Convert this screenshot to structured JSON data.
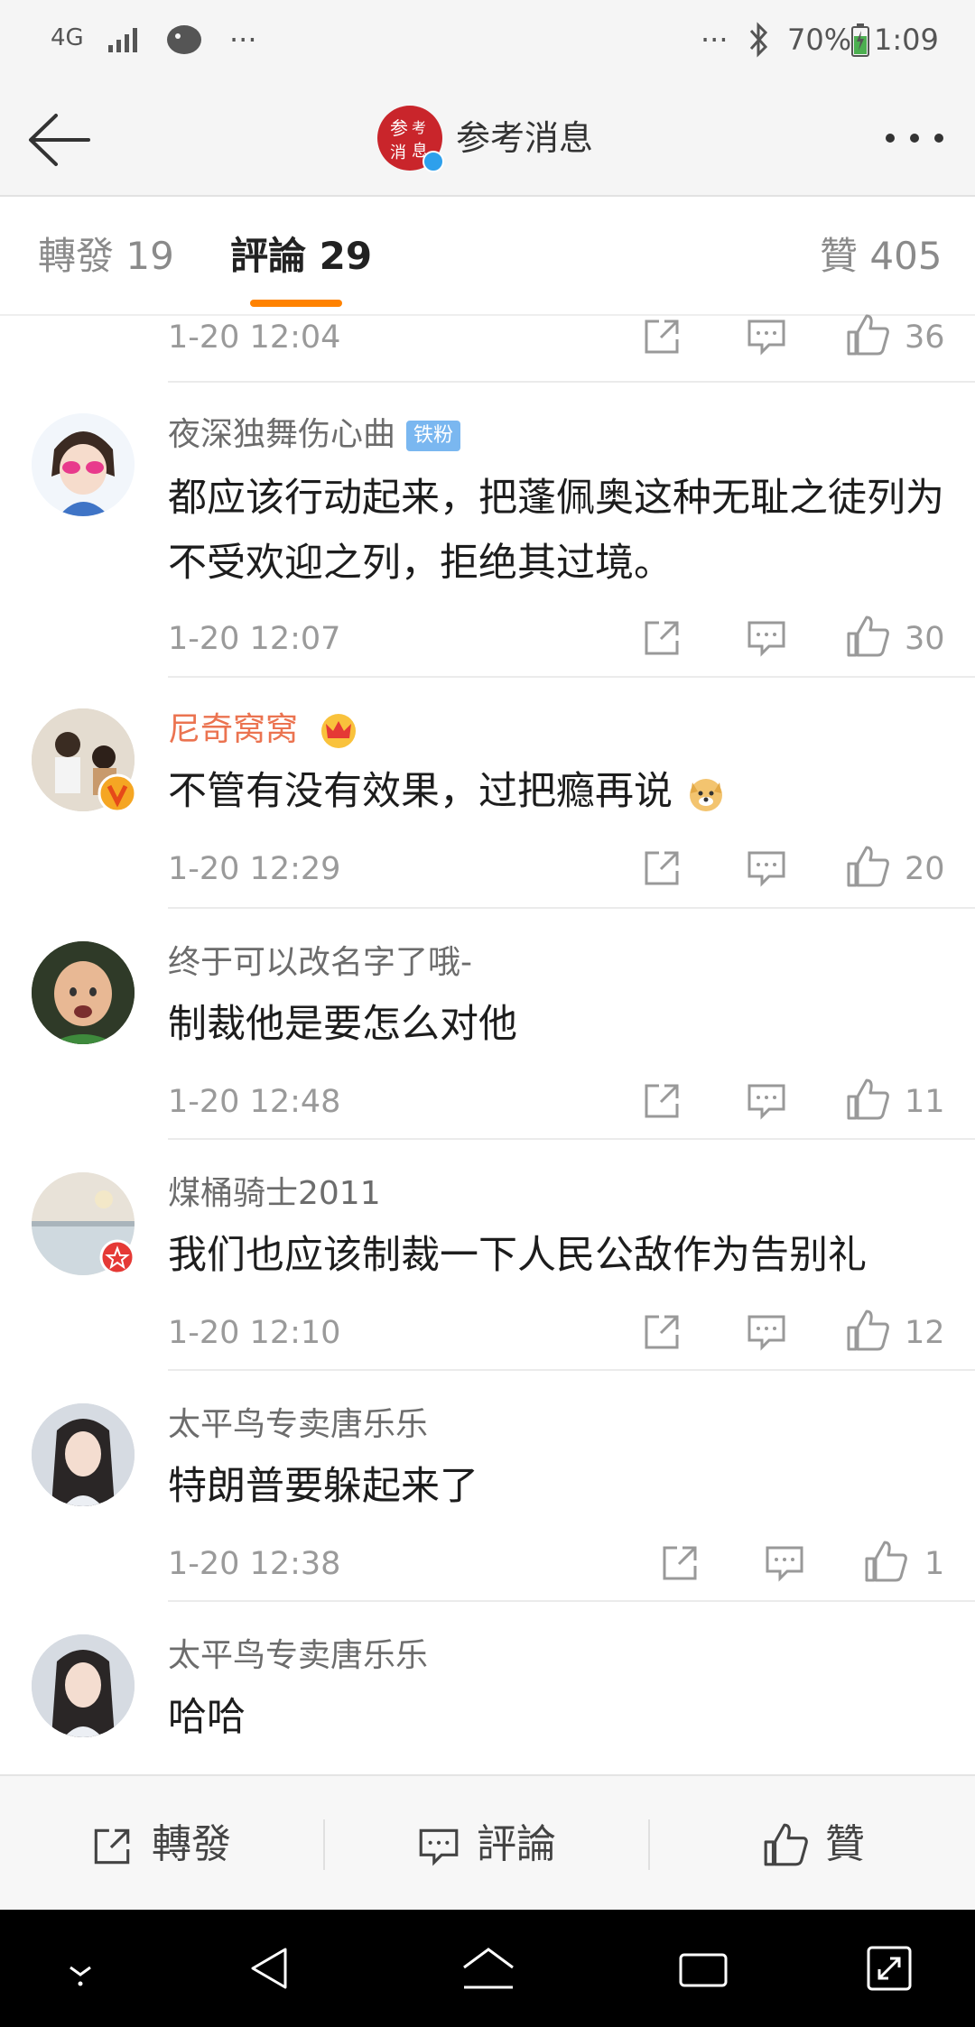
{
  "status_bar": {
    "network": "4G",
    "dots_left": "···",
    "dots_right": "···",
    "battery": "70%",
    "time": "1:09"
  },
  "header": {
    "title": "参考消息",
    "back_icon": "arrow-left-icon",
    "more_icon": "more-dots-icon"
  },
  "tabs": {
    "repost": "轉發 19",
    "comments": "評論 29",
    "likes": "贊 405"
  },
  "colors": {
    "accent": "#ff8200",
    "vip_name": "#eb7350",
    "link_tag": "#7ab7f0"
  },
  "comments": [
    {
      "time": "1-20 12:04",
      "likes": "36"
    },
    {
      "name": "夜深独舞伤心曲",
      "badge": "铁粉",
      "text": "都应该行动起来，把蓬佩奥这种无耻之徒列为不受欢迎之列，拒绝其过境。",
      "time": "1-20 12:07",
      "likes": "30"
    },
    {
      "name": "尼奇窝窝",
      "text": "不管有没有效果，过把瘾再说",
      "time": "1-20 12:29",
      "likes": "20"
    },
    {
      "name": "终于可以改名字了哦-",
      "text": "制裁他是要怎么对他",
      "time": "1-20 12:48",
      "likes": "11"
    },
    {
      "name": "煤桶骑士2011",
      "text": "我们也应该制裁一下人民公敌作为告别礼",
      "time": "1-20 12:10",
      "likes": "12"
    },
    {
      "name": "太平鸟专卖唐乐乐",
      "text": "特朗普要躲起来了",
      "time": "1-20 12:38",
      "likes": "1"
    },
    {
      "name": "太平鸟专卖唐乐乐",
      "text": "哈哈"
    }
  ],
  "bottom_bar": {
    "repost": "轉發",
    "comment": "評論",
    "like": "贊"
  }
}
